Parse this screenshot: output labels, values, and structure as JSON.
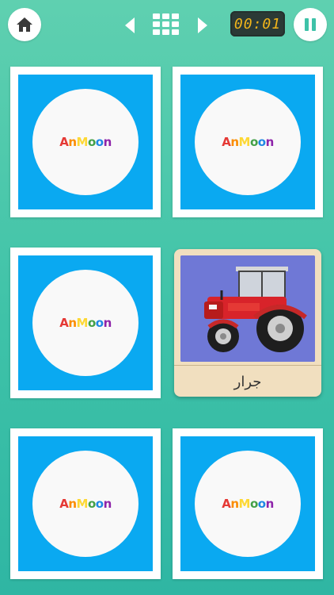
{
  "timer": "00:01",
  "logo_text": "AnMoon",
  "revealed_card": {
    "caption": "جرار",
    "image": "tractor"
  },
  "icons": {
    "home": "home-icon",
    "pause": "pause-icon",
    "prev": "chevron-left-icon",
    "grid": "grid-icon",
    "next": "chevron-right-icon"
  },
  "colors": {
    "background": "#3ec2a8",
    "card_back": "#0aa9f1",
    "timer_digits": "#f2b51a"
  }
}
